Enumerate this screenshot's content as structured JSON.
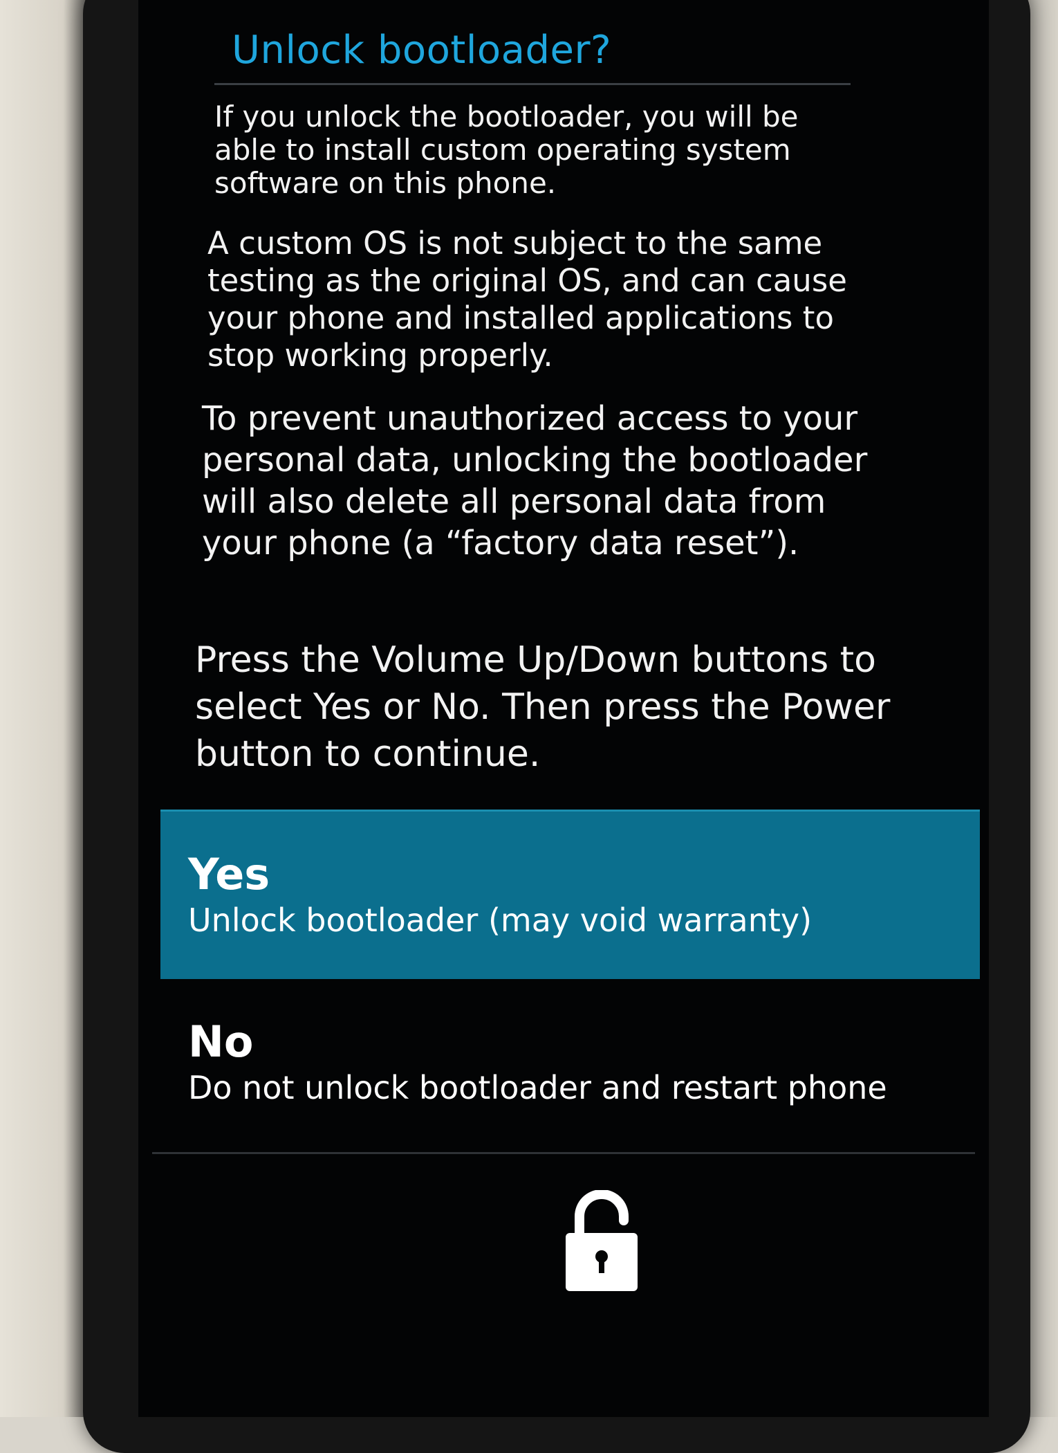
{
  "dialog": {
    "title": "Unlock bootloader?",
    "paragraphs": [
      "If you unlock the bootloader, you will be able to install custom operating system software on this phone.",
      "A custom OS is not subject to the same testing as the original OS, and can cause your phone and installed applications to stop working properly.",
      "To prevent unauthorized access to your personal data, unlocking the bootloader will also delete all personal data from your phone (a “factory data reset”).",
      "Press the Volume Up/Down buttons to select Yes or No. Then press the Power button to continue."
    ]
  },
  "options": [
    {
      "label": "Yes",
      "description": "Unlock bootloader (may void warranty)",
      "selected": true
    },
    {
      "label": "No",
      "description": "Do not unlock bootloader and restart phone",
      "selected": false
    }
  ],
  "icons": {
    "footer": "unlocked-padlock-icon"
  },
  "colors": {
    "title": "#1fa6dd",
    "selected_option_bg": "#0b6f8e",
    "screen_bg": "#030405",
    "text": "#f2f2f2"
  }
}
